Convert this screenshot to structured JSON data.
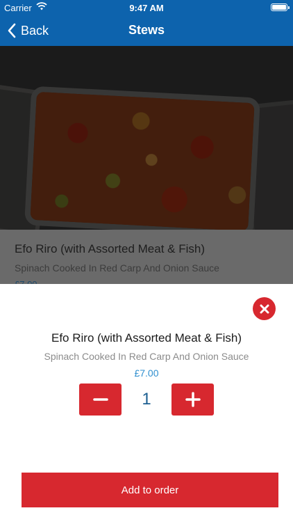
{
  "status_bar": {
    "carrier": "Carrier",
    "time": "9:47 AM"
  },
  "nav": {
    "back_label": "Back",
    "title": "Stews"
  },
  "background_item": {
    "name": "Efo Riro (with Assorted Meat & Fish)",
    "description": "Spinach Cooked In Red Carp And Onion Sauce",
    "price": "£7.00"
  },
  "sheet": {
    "name": "Efo Riro (with Assorted Meat & Fish)",
    "description": "Spinach Cooked In Red Carp And Onion Sauce",
    "price": "£7.00",
    "quantity": "1",
    "add_label": "Add to order"
  },
  "colors": {
    "nav_blue": "#0d63ad",
    "accent_red": "#d7282f",
    "price_blue": "#2f8fcf",
    "quantity_blue": "#1c5f91"
  },
  "icons": [
    "wifi-icon",
    "battery-icon",
    "back-chevron-icon",
    "close-icon",
    "minus-icon",
    "plus-icon"
  ]
}
